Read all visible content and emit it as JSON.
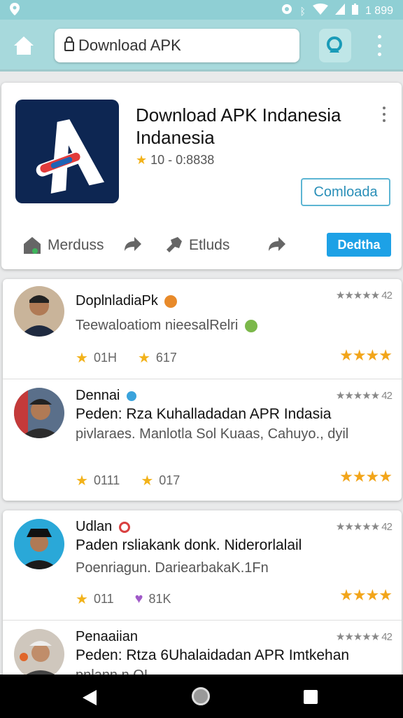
{
  "status_bar": {
    "time": "1 899"
  },
  "browser": {
    "url_text": "Download APK"
  },
  "app": {
    "title": "Download APK Indanesia Indanesia",
    "meta": "10 - 0:8838",
    "download_label": "Comloada",
    "actions": [
      {
        "label": "Merduss"
      },
      {
        "label": "Etluds"
      }
    ],
    "share_label": "Dedtha"
  },
  "reviews": [
    {
      "name": "DoplnladiaPk",
      "text": "",
      "sub": "Teewaloatiom nieesalRelri",
      "rating_top": "★★★★★ 42",
      "stat1": "01H",
      "stat2": "617",
      "stars": "★★★★"
    },
    {
      "name": "Dennai",
      "text": "Peden: Rza Kuhalladadan APR Indasia",
      "sub": "pivlaraes. Manlotla Sol Kuaas, Cahuyo., dyil",
      "rating_top": "★★★★★ 42",
      "stat1": "0111",
      "stat2": "017",
      "stars": "★★★★"
    },
    {
      "name": "Udlan",
      "text": "Paden  rsliakank donk. Niderorlalail",
      "sub": "Poenriagun. DariearbakaK.1Fn",
      "rating_top": "★★★★★ 42",
      "stat1": "011",
      "stat2": "81K",
      "stars": "★★★★"
    },
    {
      "name": "Penaaiian",
      "text": "Peden: Rtza 6Uhalaidadan APR Imtkehan",
      "sub": "pnlann  n OL",
      "rating_top": "★★★★★ 42"
    }
  ],
  "colors": {
    "accent": "#1da1e6",
    "toolbar": "#a7d9dc",
    "star": "#f2a51a",
    "icon_bg": "#0d2652"
  }
}
